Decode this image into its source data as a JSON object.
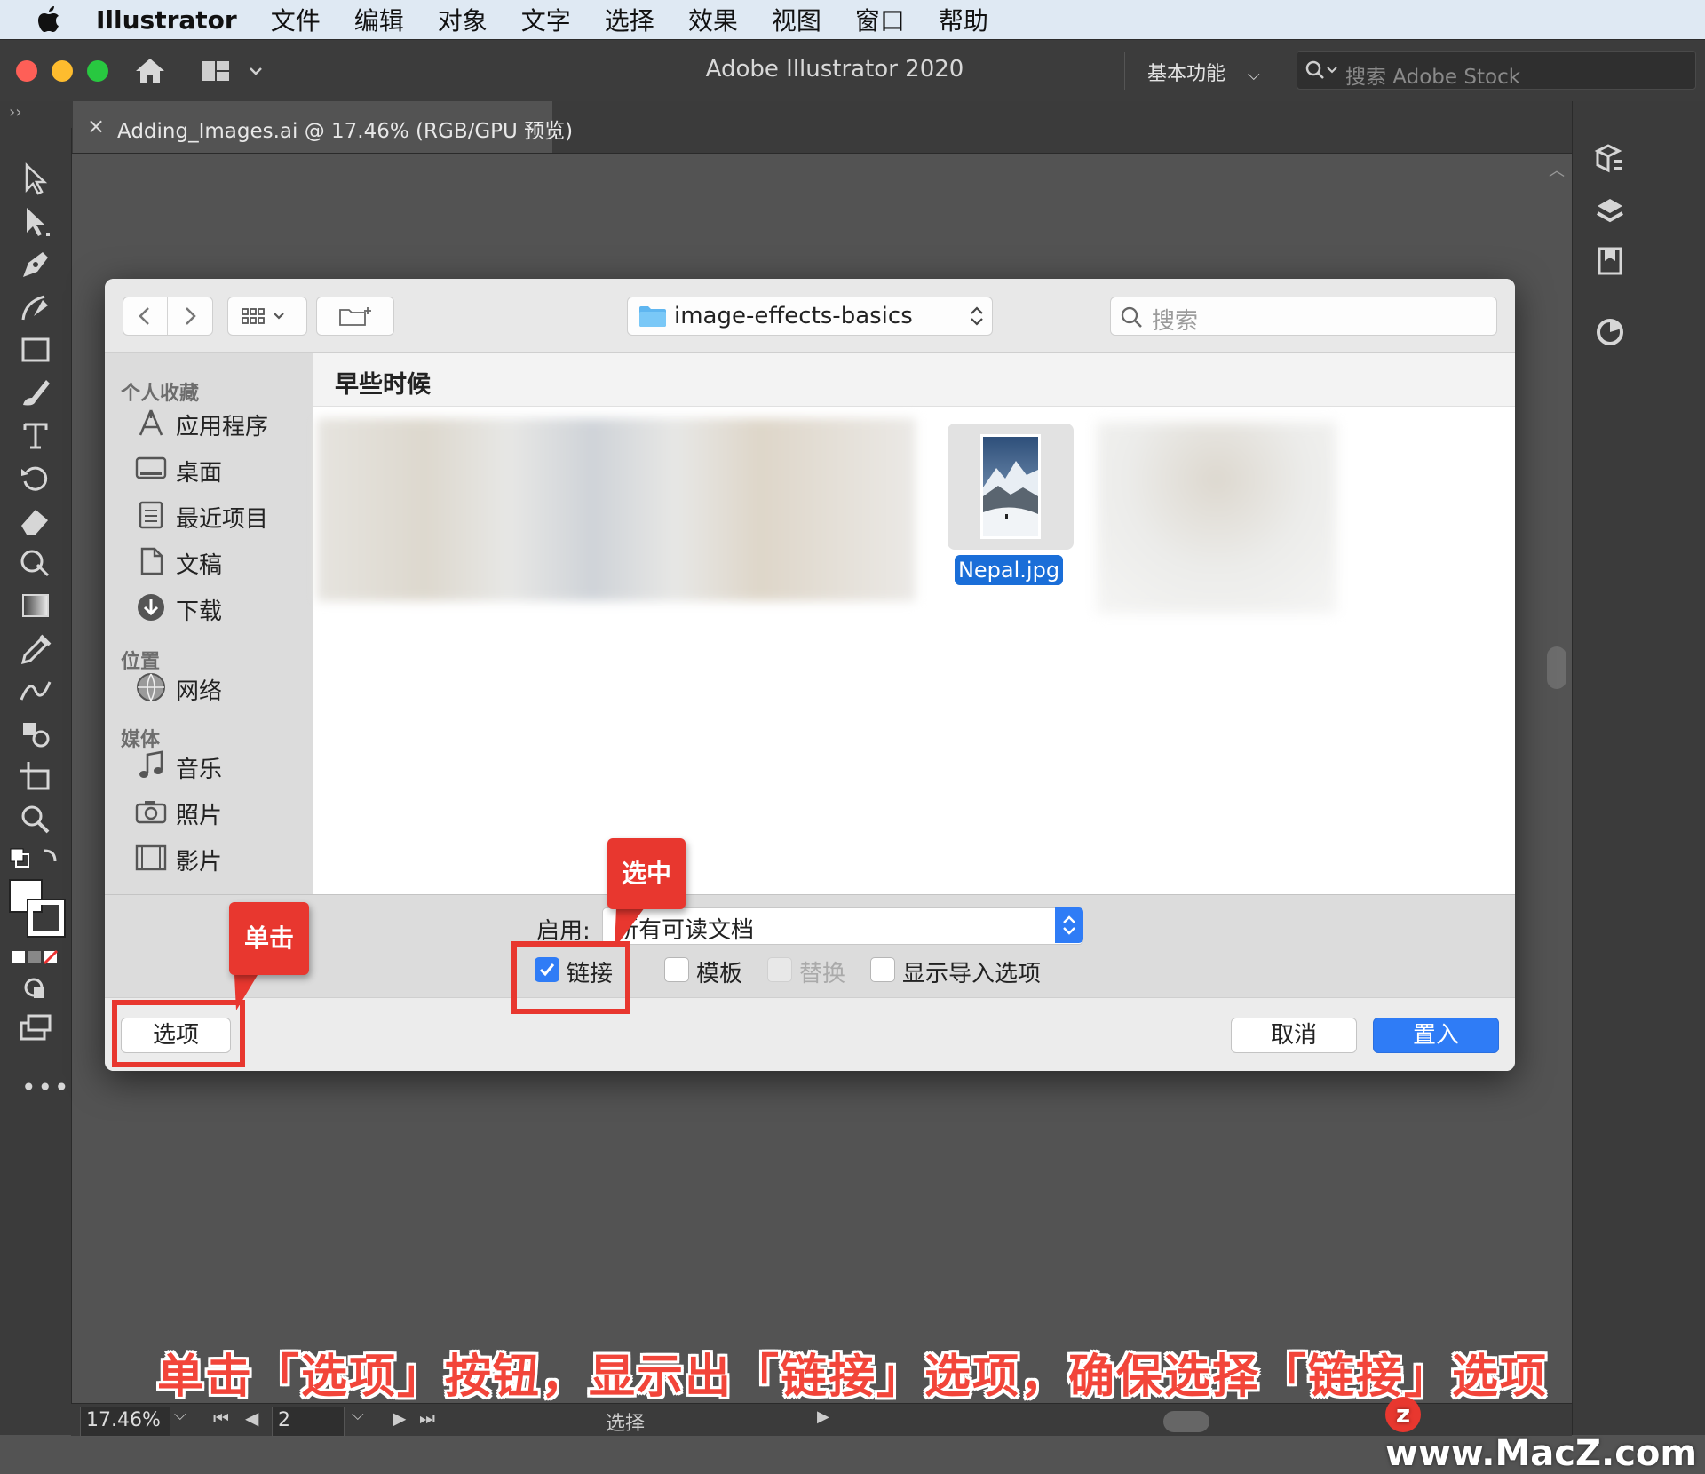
{
  "menubar": {
    "app_name": "Illustrator",
    "items": [
      "文件",
      "编辑",
      "对象",
      "文字",
      "选择",
      "效果",
      "视图",
      "窗口",
      "帮助"
    ]
  },
  "titlebar": {
    "title": "Adobe Illustrator 2020",
    "workspace": "基本功能",
    "stock_search_placeholder": "搜索 Adobe Stock"
  },
  "document_tab": {
    "close": "×",
    "title": "Adding_Images.ai @ 17.46% (RGB/GPU 预览)"
  },
  "dialog": {
    "path_folder": "image-effects-basics",
    "search_placeholder": "搜索",
    "sidebar": {
      "favorites_header": "个人收藏",
      "favorites": [
        "应用程序",
        "桌面",
        "最近项目",
        "文稿",
        "下载"
      ],
      "locations_header": "位置",
      "locations": [
        "网络"
      ],
      "media_header": "媒体",
      "media": [
        "音乐",
        "照片",
        "影片"
      ]
    },
    "group_header": "早些时候",
    "selected_file": "Nepal.jpg",
    "enable_label": "启用:",
    "enable_value": "所有可读文档",
    "checkboxes": {
      "link": {
        "label": "链接",
        "checked": true
      },
      "template": {
        "label": "模板",
        "checked": false
      },
      "replace": {
        "label": "替换",
        "checked": false
      },
      "show_import": {
        "label": "显示导入选项",
        "checked": false
      }
    },
    "options_button": "选项",
    "cancel_button": "取消",
    "place_button": "置入"
  },
  "annotations": {
    "callout_click": "单击",
    "callout_select": "选中",
    "caption": "单击「选项」按钮，显示出「链接」选项，确保选择「链接」选项"
  },
  "statusbar": {
    "zoom": "17.46%",
    "artboard": "2",
    "mode": "选择"
  },
  "watermark": "www.MacZ.com",
  "colors": {
    "accent": "#2f7cf6",
    "annotation_red": "#e8372f",
    "ui_dark": "#3b3b3b",
    "canvas": "#535353"
  }
}
